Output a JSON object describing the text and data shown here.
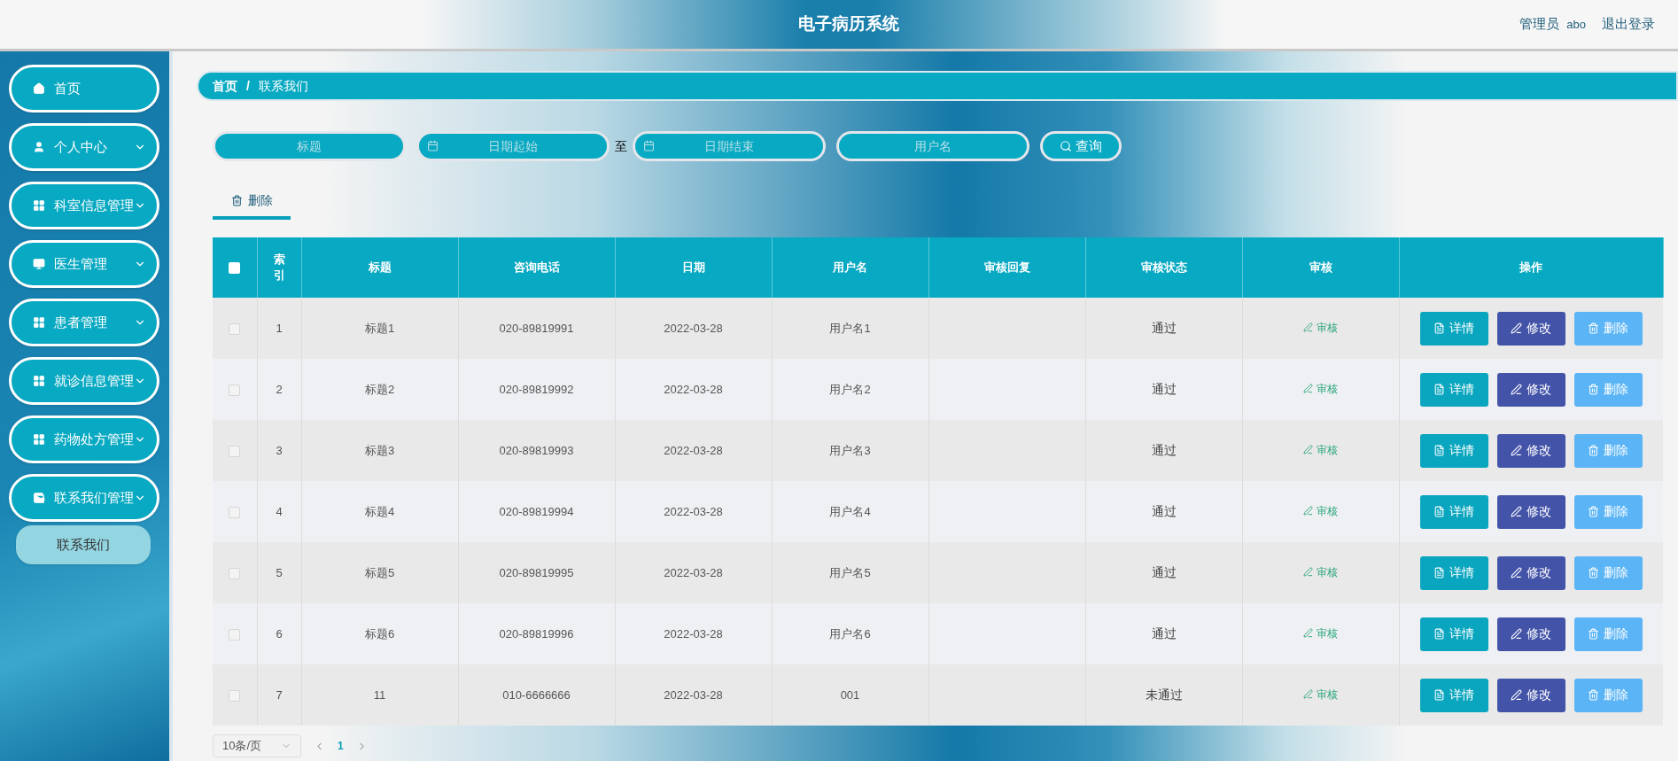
{
  "header": {
    "title": "电子病历系统",
    "role": "管理员",
    "username": "abo",
    "logout": "退出登录"
  },
  "sidebar": {
    "items": [
      {
        "label": "首页",
        "expandable": false
      },
      {
        "label": "个人中心",
        "expandable": true
      },
      {
        "label": "科室信息管理",
        "expandable": true
      },
      {
        "label": "医生管理",
        "expandable": true
      },
      {
        "label": "患者管理",
        "expandable": true
      },
      {
        "label": "就诊信息管理",
        "expandable": true
      },
      {
        "label": "药物处方管理",
        "expandable": true
      },
      {
        "label": "联系我们管理",
        "expandable": true,
        "children": [
          {
            "label": "联系我们",
            "selected": true
          }
        ]
      }
    ]
  },
  "breadcrumb": {
    "items": [
      "首页",
      "联系我们"
    ],
    "separator": "/"
  },
  "search": {
    "fields": [
      {
        "kind": "text",
        "placeholder": "标题"
      },
      {
        "kind": "date",
        "placeholder": "日期起始"
      },
      {
        "kind": "range",
        "label": "至"
      },
      {
        "kind": "date",
        "placeholder": "日期结束"
      },
      {
        "kind": "text",
        "placeholder": "用户名"
      }
    ],
    "button": "查询"
  },
  "toolbar": {
    "tabs": [
      {
        "label": "删除",
        "selected": true
      }
    ]
  },
  "table": {
    "select_all": {
      "checked": false
    },
    "columns": [
      "索引",
      "标题",
      "咨询电话",
      "日期",
      "用户名",
      "审核回复",
      "审核状态",
      "审核",
      "操作"
    ],
    "rows": [
      {
        "checked": false,
        "cells": [
          "1",
          "标题1",
          "020-89819991",
          "2022-03-28",
          "用户名1",
          "",
          "通过"
        ],
        "audit": "审核",
        "actions": [
          "详情",
          "修改",
          "删除"
        ]
      },
      {
        "checked": false,
        "cells": [
          "2",
          "标题2",
          "020-89819992",
          "2022-03-28",
          "用户名2",
          "",
          "通过"
        ],
        "audit": "审核",
        "actions": [
          "详情",
          "修改",
          "删除"
        ]
      },
      {
        "checked": false,
        "cells": [
          "3",
          "标题3",
          "020-89819993",
          "2022-03-28",
          "用户名3",
          "",
          "通过"
        ],
        "audit": "审核",
        "actions": [
          "详情",
          "修改",
          "删除"
        ]
      },
      {
        "checked": false,
        "cells": [
          "4",
          "标题4",
          "020-89819994",
          "2022-03-28",
          "用户名4",
          "",
          "通过"
        ],
        "audit": "审核",
        "actions": [
          "详情",
          "修改",
          "删除"
        ]
      },
      {
        "checked": false,
        "cells": [
          "5",
          "标题5",
          "020-89819995",
          "2022-03-28",
          "用户名5",
          "",
          "通过"
        ],
        "audit": "审核",
        "actions": [
          "详情",
          "修改",
          "删除"
        ]
      },
      {
        "checked": false,
        "cells": [
          "6",
          "标题6",
          "020-89819996",
          "2022-03-28",
          "用户名6",
          "",
          "通过"
        ],
        "audit": "审核",
        "actions": [
          "详情",
          "修改",
          "删除"
        ]
      },
      {
        "checked": false,
        "cells": [
          "7",
          "11",
          "010-6666666",
          "2022-03-28",
          "001",
          "",
          "未通过"
        ],
        "audit": "审核",
        "actions": [
          "详情",
          "修改",
          "删除"
        ]
      }
    ]
  },
  "pagination": {
    "page_size": "10条/页",
    "pages": [
      {
        "label": "1",
        "selected": true
      }
    ]
  }
}
